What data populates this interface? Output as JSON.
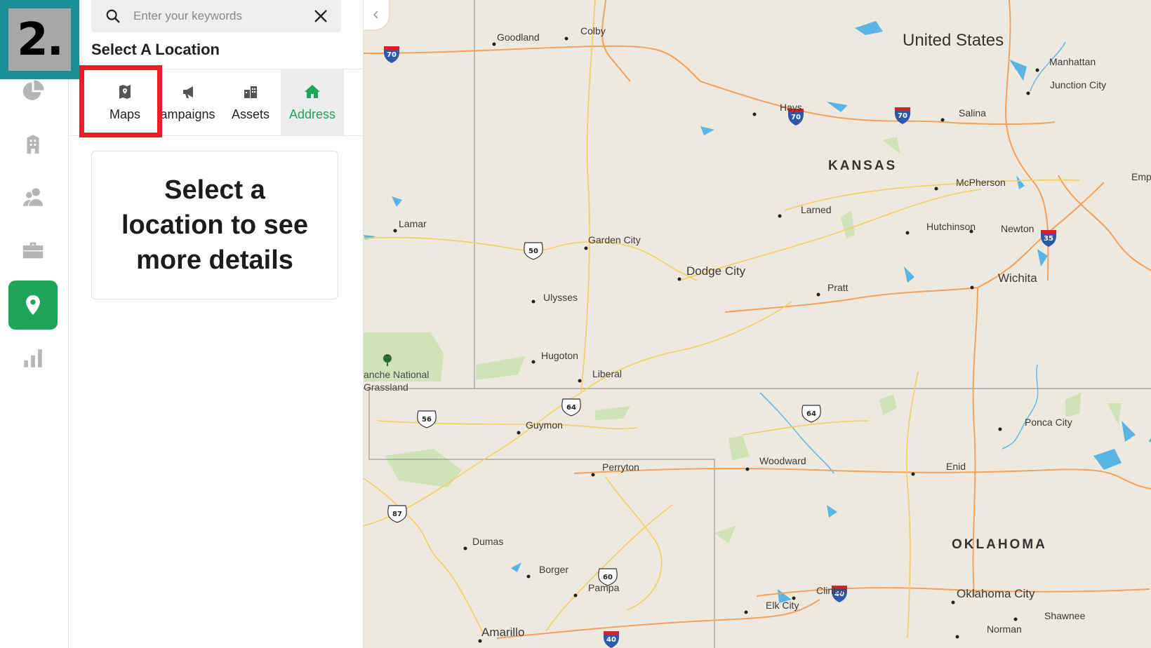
{
  "step_badge": {
    "text": "2."
  },
  "rail": {
    "items": [
      {
        "name": "dashboard",
        "icon": "pie-chart-icon"
      },
      {
        "name": "properties",
        "icon": "building-icon"
      },
      {
        "name": "contacts",
        "icon": "users-icon"
      },
      {
        "name": "portfolio",
        "icon": "briefcase-icon"
      },
      {
        "name": "locations",
        "icon": "location-pin-icon",
        "active": true
      },
      {
        "name": "reports",
        "icon": "bar-chart-icon"
      }
    ]
  },
  "search": {
    "placeholder": "Enter your keywords",
    "value": ""
  },
  "panel": {
    "heading": "Select A Location",
    "tabs": [
      {
        "label": "Maps",
        "icon": "map-icon"
      },
      {
        "label": "Campaigns",
        "icon": "megaphone-icon"
      },
      {
        "label": "Assets",
        "icon": "buildings-icon"
      },
      {
        "label": "Address",
        "icon": "home-icon",
        "active": true
      }
    ],
    "details_message": "Select a location to see more details"
  },
  "map": {
    "country": "United States",
    "states": [
      "KANSAS",
      "OKLAHOMA"
    ],
    "park": [
      "anche National",
      "Grassland"
    ],
    "cities": [
      "Goodland",
      "Colby",
      "Manhattan",
      "Junction City",
      "Hays",
      "Salina",
      "Emp",
      "McPherson",
      "Larned",
      "Hutchinson",
      "Newton",
      "Lamar",
      "Garden City",
      "Dodge City",
      "Wichita",
      "Pratt",
      "Ulysses",
      "Hugoton",
      "Liberal",
      "Guymon",
      "Ponca City",
      "Woodward",
      "Enid",
      "Perryton",
      "Dumas",
      "Borger",
      "Pampa",
      "Clinton",
      "Elk City",
      "Oklahoma City",
      "Shawnee",
      "Norman",
      "Amarillo"
    ],
    "highway_shields": [
      "70",
      "70",
      "70",
      "50",
      "35",
      "64",
      "56",
      "64",
      "87",
      "60",
      "40",
      "40"
    ]
  },
  "colors": {
    "accent_green": "#1fa55a",
    "badge_teal": "#1b8f96",
    "highlight_red": "#ee1c24",
    "map_land": "#ede9df",
    "map_water": "#5bb4e6",
    "map_highway": "#f5a15a",
    "map_road": "#f2cf61"
  }
}
